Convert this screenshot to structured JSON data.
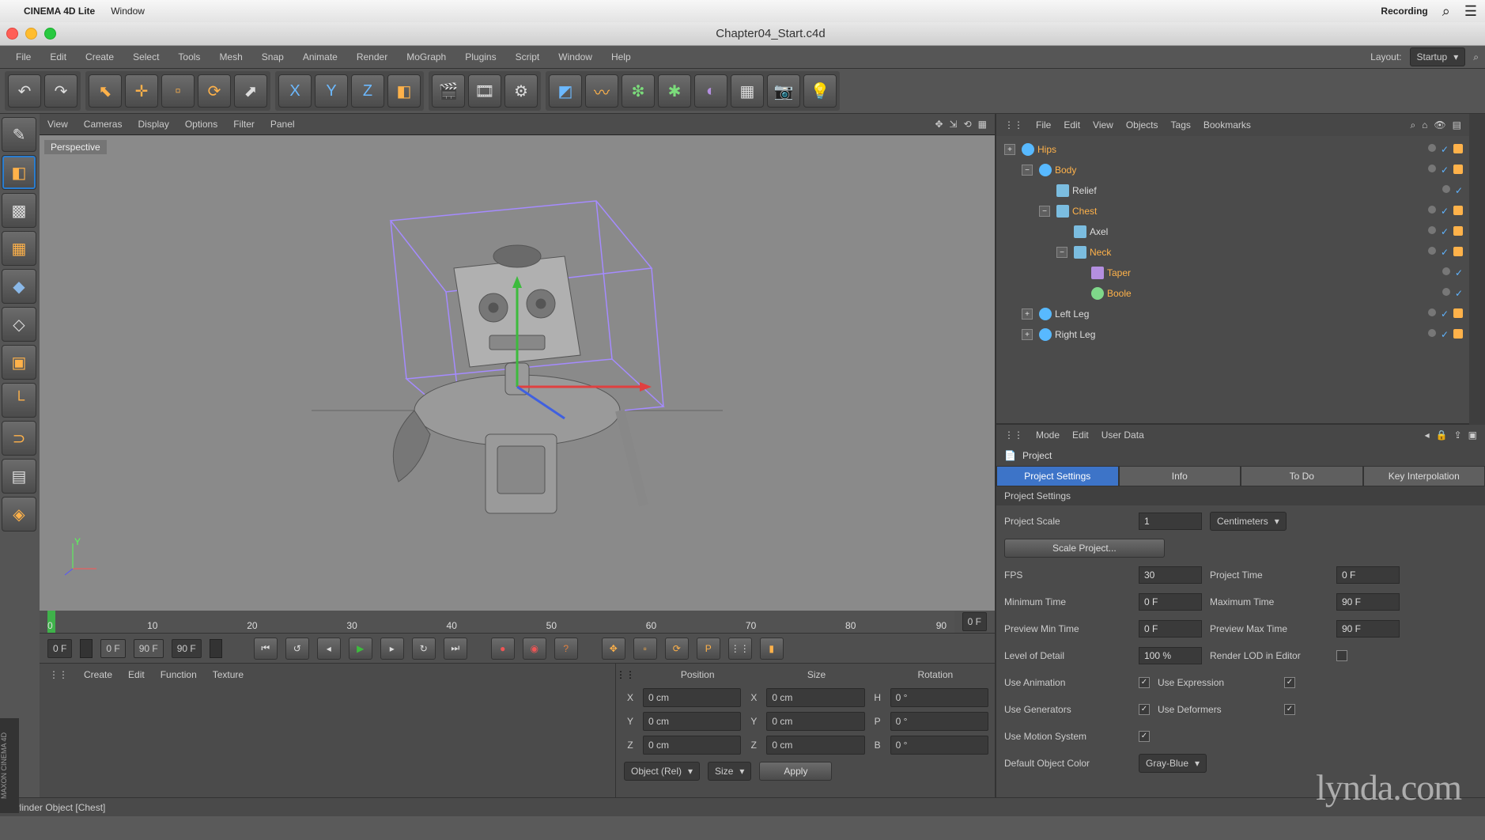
{
  "mac_menu": {
    "app": "CINEMA 4D Lite",
    "items": [
      "Window"
    ],
    "status": "Recording"
  },
  "window": {
    "title": "Chapter04_Start.c4d"
  },
  "app_menu": {
    "items": [
      "File",
      "Edit",
      "Create",
      "Select",
      "Tools",
      "Mesh",
      "Snap",
      "Animate",
      "Render",
      "MoGraph",
      "Plugins",
      "Script",
      "Window",
      "Help"
    ],
    "layout_label": "Layout:",
    "layout_value": "Startup"
  },
  "viewport_menu": {
    "items": [
      "View",
      "Cameras",
      "Display",
      "Options",
      "Filter",
      "Panel"
    ],
    "label": "Perspective"
  },
  "timeline": {
    "ticks": [
      "0",
      "10",
      "20",
      "30",
      "40",
      "50",
      "60",
      "70",
      "80",
      "90"
    ],
    "current": "0 F"
  },
  "transport": {
    "cur": "0 F",
    "range_start": "0 F",
    "range_end": "90 F",
    "end": "90 F"
  },
  "materials_menu": {
    "items": [
      "Create",
      "Edit",
      "Function",
      "Texture"
    ]
  },
  "coords": {
    "headers": [
      "Position",
      "Size",
      "Rotation"
    ],
    "rows": [
      {
        "axis": "X",
        "pos": "0 cm",
        "size": "0 cm",
        "rotlbl": "H",
        "rot": "0 °"
      },
      {
        "axis": "Y",
        "pos": "0 cm",
        "size": "0 cm",
        "rotlbl": "P",
        "rot": "0 °"
      },
      {
        "axis": "Z",
        "pos": "0 cm",
        "size": "0 cm",
        "rotlbl": "B",
        "rot": "0 °"
      }
    ],
    "mode": "Object (Rel)",
    "size_mode": "Size",
    "apply": "Apply"
  },
  "status": "Cylinder Object [Chest]",
  "om_menu": {
    "items": [
      "File",
      "Edit",
      "View",
      "Objects",
      "Tags",
      "Bookmarks"
    ]
  },
  "tree": [
    {
      "depth": 0,
      "exp": "+",
      "icon": "null",
      "name": "Hips",
      "hot": true,
      "tag": true
    },
    {
      "depth": 1,
      "exp": "−",
      "icon": "null",
      "name": "Body",
      "hot": true,
      "tag": true
    },
    {
      "depth": 2,
      "exp": "",
      "icon": "cube",
      "name": "Relief",
      "hot": false,
      "tag": false
    },
    {
      "depth": 2,
      "exp": "−",
      "icon": "cyl",
      "name": "Chest",
      "hot": true,
      "tag": true
    },
    {
      "depth": 3,
      "exp": "",
      "icon": "cyl",
      "name": "Axel",
      "hot": false,
      "tag": true
    },
    {
      "depth": 3,
      "exp": "−",
      "icon": "cyl",
      "name": "Neck",
      "hot": true,
      "tag": true
    },
    {
      "depth": 4,
      "exp": "",
      "icon": "def",
      "name": "Taper",
      "hot": true,
      "tag": false
    },
    {
      "depth": 4,
      "exp": "",
      "icon": "bool",
      "name": "Boole",
      "hot": true,
      "tag": false
    },
    {
      "depth": 1,
      "exp": "+",
      "icon": "null",
      "name": "Left Leg",
      "hot": false,
      "tag": true
    },
    {
      "depth": 1,
      "exp": "+",
      "icon": "null",
      "name": "Right Leg",
      "hot": false,
      "tag": true
    }
  ],
  "am_menu": {
    "items": [
      "Mode",
      "Edit",
      "User Data"
    ]
  },
  "am_name": "Project",
  "am_tabs": [
    "Project Settings",
    "Info",
    "To Do",
    "Key Interpolation"
  ],
  "am_section": "Project Settings",
  "project": {
    "scale_label": "Project Scale",
    "scale_value": "1",
    "scale_unit": "Centimeters",
    "scale_button": "Scale Project...",
    "fps_label": "FPS",
    "fps": "30",
    "project_time_label": "Project Time",
    "project_time": "0 F",
    "min_time_label": "Minimum Time",
    "min_time": "0 F",
    "max_time_label": "Maximum Time",
    "max_time": "90 F",
    "pmin_label": "Preview Min Time",
    "pmin": "0 F",
    "pmax_label": "Preview Max Time",
    "pmax": "90 F",
    "lod_label": "Level of Detail",
    "lod": "100 %",
    "render_lod_label": "Render LOD in Editor",
    "use_anim": "Use Animation",
    "use_expr": "Use Expression",
    "use_gen": "Use Generators",
    "use_def": "Use Deformers",
    "use_motion": "Use Motion System",
    "def_color_label": "Default Object Color",
    "def_color": "Gray-Blue"
  },
  "watermark": "lynda.com"
}
